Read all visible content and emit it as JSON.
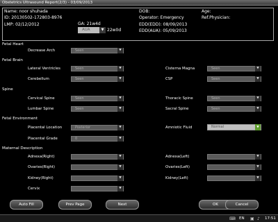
{
  "window": {
    "title": "Obstetrics Ultrasound Report(2/3) - 03/09/2013"
  },
  "patient": {
    "name": "Name: noor shuhada",
    "dob": "DOB:",
    "age": "Age:",
    "id": "ID: 20130502-172803-8976",
    "operator": "Operator: Emergency",
    "ref_physician": "Ref.Physician:",
    "lmp": "LMP: 02/12/2012",
    "ga": "GA: 21w4d",
    "edd_lmp": "EDD(EDD): 08/09/2013",
    "aua_select": "AUA",
    "aua_value": "22w0d",
    "edd_aua": "EDD(AUA): 05/09/2013"
  },
  "sections": {
    "fetal_heart": "Fetal Heart",
    "fetal_brain": "Fetal Brain",
    "spine": "Spine",
    "fetal_environment": "Fetal Environment",
    "maternal": "Maternal Description"
  },
  "fields": {
    "decrease_arch": {
      "label": "Decrease Arch",
      "value": "Seen"
    },
    "lateral_ventricles": {
      "label": "Lateral Ventricles",
      "value": "Seen"
    },
    "cisterna_magna": {
      "label": "Cisterna Magna",
      "value": "Seen"
    },
    "cerebellum": {
      "label": "Cerebellum",
      "value": "Seen"
    },
    "csp": {
      "label": "CSP",
      "value": "Seen"
    },
    "cervical_spine": {
      "label": "Cervical Spine",
      "value": "Seen"
    },
    "thoracic_spine": {
      "label": "Thoracic Spine",
      "value": "Seen"
    },
    "lumbar_spine": {
      "label": "Lumbar Spine",
      "value": "Seen"
    },
    "sacral_spine": {
      "label": "Sacral Spine",
      "value": "Seen"
    },
    "placental_location": {
      "label": "Placental Location",
      "value": "Posterior"
    },
    "amniotic_fluid": {
      "label": "Amniotic Fluid",
      "value": "Normal"
    },
    "placental_grade": {
      "label": "Placental Grade",
      "value": "0"
    },
    "adnexa_right": {
      "label": "Adnexa(Right)",
      "value": ""
    },
    "adnexa_left": {
      "label": "Adnexa(Left)",
      "value": ""
    },
    "ovaries_right": {
      "label": "Ovaries(Right)",
      "value": ""
    },
    "ovaries_left": {
      "label": "Ovaries(Left)",
      "value": ""
    },
    "kidney_right": {
      "label": "Kidney(Right)",
      "value": ""
    },
    "kidney_left": {
      "label": "Kidney(Left)",
      "value": ""
    },
    "cervix": {
      "label": "Cervix",
      "value": ""
    }
  },
  "buttons": {
    "auto_fill": "Auto Fill",
    "prev_page": "Prev Page",
    "next": "Next",
    "ok": "OK",
    "cancel": "Cancel"
  },
  "taskbar": {
    "lang": "EN",
    "time": "17:51"
  },
  "colors": {
    "amniotic_arrow": "#5d9b2c",
    "field_bg": "#5a5a5a"
  }
}
